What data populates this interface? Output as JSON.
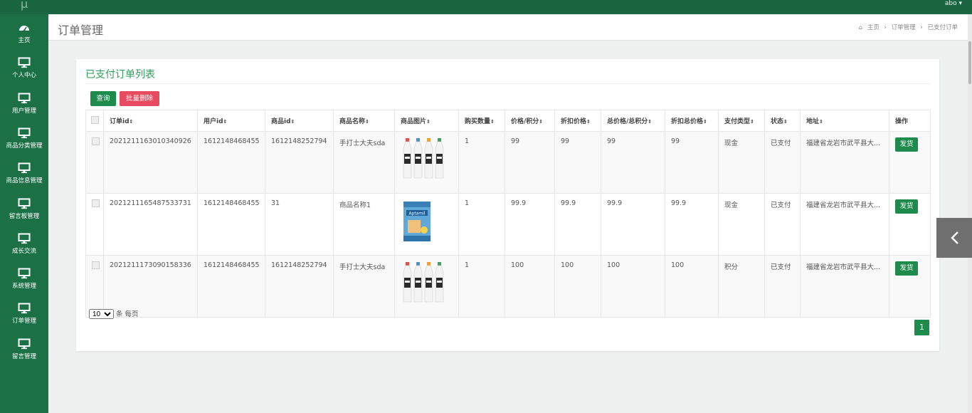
{
  "topbar": {
    "logo": "μ",
    "user": "abo ▾"
  },
  "sidebar": {
    "items": [
      {
        "label": "主页",
        "icon": "dashboard-icon"
      },
      {
        "label": "个人中心",
        "icon": "monitor-icon"
      },
      {
        "label": "用户管理",
        "icon": "monitor-icon"
      },
      {
        "label": "商品分类管理",
        "icon": "monitor-icon"
      },
      {
        "label": "商品信息管理",
        "icon": "monitor-icon"
      },
      {
        "label": "留言板管理",
        "icon": "monitor-icon"
      },
      {
        "label": "成长交流",
        "icon": "monitor-icon"
      },
      {
        "label": "系统管理",
        "icon": "monitor-icon"
      },
      {
        "label": "订单管理",
        "icon": "monitor-icon"
      },
      {
        "label": "留言管理",
        "icon": "monitor-icon"
      }
    ]
  },
  "header": {
    "title": "订单管理",
    "breadcrumb": [
      "主页",
      "订单管理",
      "已支付订单"
    ]
  },
  "card": {
    "title": "已支付订单列表",
    "query_label": "查询",
    "batch_delete_label": "批量删除"
  },
  "table": {
    "columns": [
      "订单id",
      "用户id",
      "商品id",
      "商品名称",
      "商品图片",
      "购买数量",
      "价格/积分",
      "折扣价格",
      "总价格/总积分",
      "折扣总价格",
      "支付类型",
      "状态",
      "地址",
      "操作"
    ],
    "rows": [
      {
        "order_id": "20212111630103409​26",
        "user_id": "1612148468455",
        "goods_id": "1612148252794",
        "name": "手打士大夫sda",
        "image": "milk-bottles",
        "qty": "1",
        "price": "99",
        "discount": "99",
        "total": "99",
        "discount_total": "99",
        "pay_type": "现金",
        "status": "已支付",
        "address": "福建省龙岩市武平县大...",
        "action": "发货"
      },
      {
        "order_id": "20212111654875337​31",
        "user_id": "1612148468455",
        "goods_id": "31",
        "name": "商品名称1",
        "image": "formula-can",
        "qty": "1",
        "price": "99.9",
        "discount": "99.9",
        "total": "99.9",
        "discount_total": "99.9",
        "pay_type": "现金",
        "status": "已支付",
        "address": "福建省龙岩市武平县大...",
        "action": "发货"
      },
      {
        "order_id": "20212111730901583​36",
        "user_id": "1612148468455",
        "goods_id": "1612148252794",
        "name": "手打士大夫sda",
        "image": "milk-bottles",
        "qty": "1",
        "price": "100",
        "discount": "100",
        "total": "100",
        "discount_total": "100",
        "pay_type": "积分",
        "status": "已支付",
        "address": "福建省龙岩市武平县大...",
        "action": "发货"
      }
    ]
  },
  "pager": {
    "page_size": "10",
    "size_suffix": "条 每页",
    "current_page": "1"
  },
  "colors": {
    "sidebar": "#1b7045",
    "accent": "#1e8a4c",
    "danger": "#e84a5f"
  }
}
